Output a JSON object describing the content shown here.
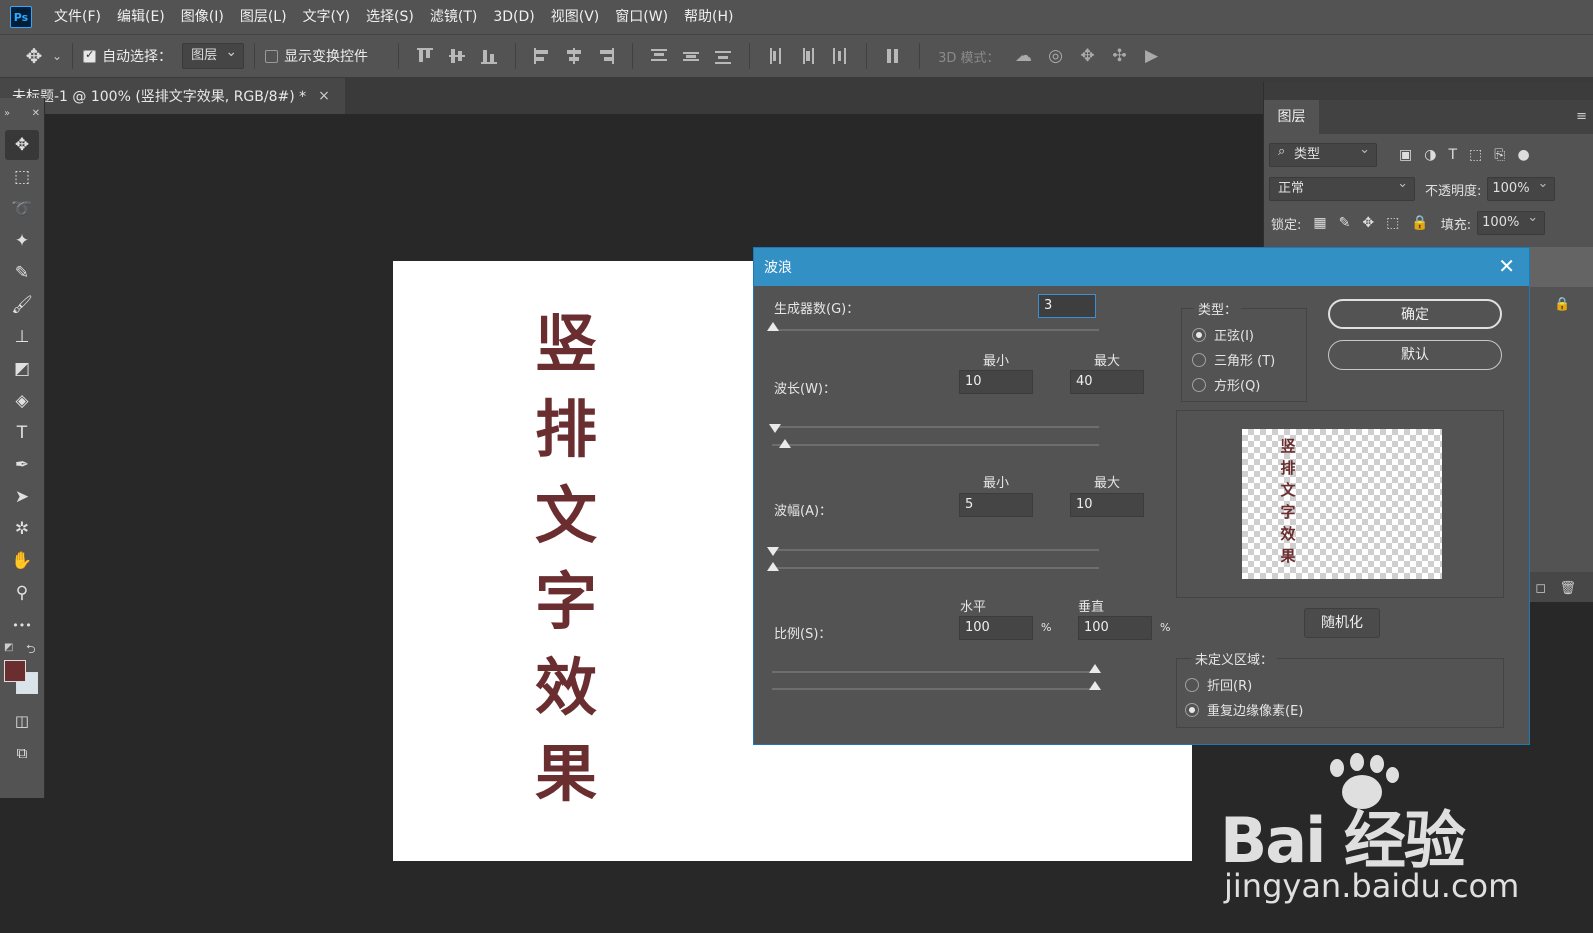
{
  "app": {
    "logo_text": "Ps"
  },
  "menu": [
    "文件(F)",
    "编辑(E)",
    "图像(I)",
    "图层(L)",
    "文字(Y)",
    "选择(S)",
    "滤镜(T)",
    "3D(D)",
    "视图(V)",
    "窗口(W)",
    "帮助(H)"
  ],
  "options": {
    "auto_select_label": "自动选择：",
    "auto_select_checked": true,
    "auto_select_target": "图层",
    "show_transform_label": "显示变换控件",
    "show_transform_checked": false,
    "mode_3d_label": "3D 模式："
  },
  "document": {
    "tab_title": "未标题-1 @ 100% (竖排文字效果, RGB/8#) *",
    "close_glyph": "×",
    "text_chars": [
      "竖",
      "排",
      "文",
      "字",
      "效",
      "果"
    ],
    "text_color": "#6b2e30"
  },
  "toolbar": {
    "tools": [
      {
        "name": "move-tool",
        "glyph": "✥"
      },
      {
        "name": "marquee-tool",
        "glyph": "⬚"
      },
      {
        "name": "lasso-tool",
        "glyph": "➰"
      },
      {
        "name": "magic-wand-tool",
        "glyph": "✦"
      },
      {
        "name": "eyedropper-tool",
        "glyph": "✎"
      },
      {
        "name": "brush-tool",
        "glyph": "🖌"
      },
      {
        "name": "stamp-tool",
        "glyph": "⊥"
      },
      {
        "name": "eraser-tool",
        "glyph": "◩"
      },
      {
        "name": "paint-bucket-tool",
        "glyph": "◈"
      },
      {
        "name": "type-tool",
        "glyph": "T"
      },
      {
        "name": "pen-tool",
        "glyph": "✒"
      },
      {
        "name": "path-select-tool",
        "glyph": "➤"
      },
      {
        "name": "shape-tool",
        "glyph": "✲"
      },
      {
        "name": "hand-tool",
        "glyph": "✋"
      },
      {
        "name": "zoom-tool",
        "glyph": "⚲"
      },
      {
        "name": "more-tools",
        "glyph": "•••"
      }
    ],
    "foreground_color": "#6b2e30",
    "background_color": "#d9e4ea"
  },
  "layers_panel": {
    "tab_label": "图层",
    "filter_label": "类型",
    "blend_mode": "正常",
    "opacity_label": "不透明度:",
    "opacity_value": "100%",
    "lock_label": "锁定:",
    "fill_label": "填充:",
    "fill_value": "100%"
  },
  "dialog": {
    "title": "波浪",
    "close_glyph": "✕",
    "generators_label": "生成器数(G)：",
    "generators_value": "3",
    "min_label": "最小",
    "max_label": "最大",
    "wavelength_label": "波长(W)：",
    "wavelength_min": "10",
    "wavelength_max": "40",
    "amplitude_label": "波幅(A)：",
    "amplitude_min": "5",
    "amplitude_max": "10",
    "horizontal_label": "水平",
    "vertical_label": "垂直",
    "scale_label": "比例(S)：",
    "scale_h": "100",
    "scale_v": "100",
    "percent": "%",
    "type_group_label": "类型：",
    "type_options": [
      {
        "label": "正弦(I)",
        "selected": true
      },
      {
        "label": "三角形 (T)",
        "selected": false
      },
      {
        "label": "方形(Q)",
        "selected": false
      }
    ],
    "ok_label": "确定",
    "default_label": "默认",
    "randomize_label": "随机化",
    "undefined_group_label": "未定义区域：",
    "undefined_options": [
      {
        "label": "折回(R)",
        "selected": false
      },
      {
        "label": "重复边缘像素(E)",
        "selected": true
      }
    ]
  },
  "watermark": {
    "logo_text": "Bai 经验",
    "url": "jingyan.baidu.com"
  }
}
